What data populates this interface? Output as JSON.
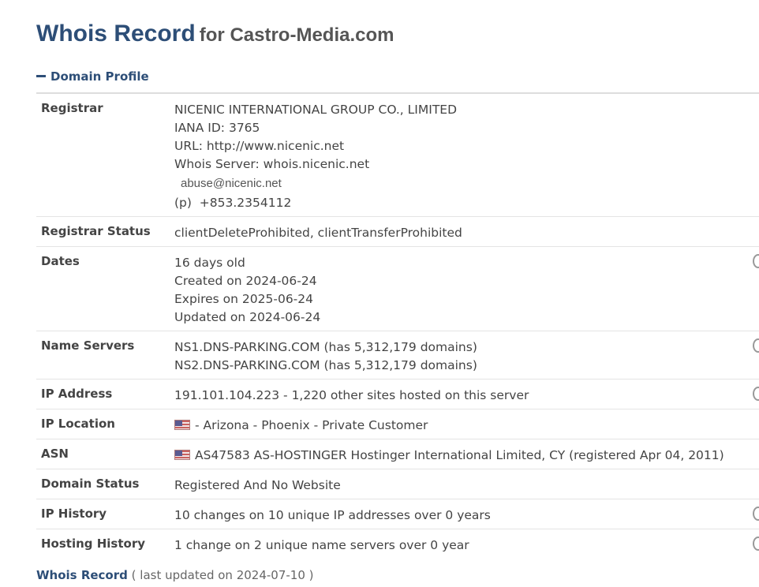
{
  "header": {
    "title": "Whois Record",
    "subtitle": "for Castro-Media.com"
  },
  "section": {
    "label": "Domain Profile"
  },
  "rows": {
    "registrar": {
      "label": "Registrar",
      "name": "NICENIC INTERNATIONAL GROUP CO., LIMITED",
      "iana": "IANA ID: 3765",
      "url": "URL: http://www.nicenic.net",
      "whois_server": "Whois Server: whois.nicenic.net",
      "abuse_email": "abuse@nicenic.net",
      "phone_prefix": "(p)",
      "phone": "+853.2354112"
    },
    "registrar_status": {
      "label": "Registrar Status",
      "value": "clientDeleteProhibited, clientTransferProhibited"
    },
    "dates": {
      "label": "Dates",
      "age": "16 days old",
      "created": "Created on 2024-06-24",
      "expires": "Expires on 2025-06-24",
      "updated": "Updated on 2024-06-24"
    },
    "name_servers": {
      "label": "Name Servers",
      "ns1": "NS1.DNS-PARKING.COM (has 5,312,179 domains)",
      "ns2": "NS2.DNS-PARKING.COM (has 5,312,179 domains)"
    },
    "ip_address": {
      "label": "IP Address",
      "value": "191.101.104.223 - 1,220 other sites hosted on this server"
    },
    "ip_location": {
      "label": "IP Location",
      "value": "- Arizona - Phoenix - Private Customer",
      "flag_icon": "us-flag-icon"
    },
    "asn": {
      "label": "ASN",
      "value": "AS47583 AS-HOSTINGER Hostinger International Limited, CY (registered Apr 04, 2011)",
      "flag_icon": "us-flag-icon"
    },
    "domain_status": {
      "label": "Domain Status",
      "value": "Registered And No Website"
    },
    "ip_history": {
      "label": "IP History",
      "value": "10 changes on 10 unique IP addresses over 0 years"
    },
    "hosting_history": {
      "label": "Hosting History",
      "value": "1 change on 2 unique name servers over 0 year"
    }
  },
  "footer": {
    "link": "Whois Record",
    "meta": "( last updated on 2024-07-10 )"
  },
  "colors": {
    "heading": "#2d4e77",
    "text": "#444444",
    "border": "#e4e4e4"
  }
}
